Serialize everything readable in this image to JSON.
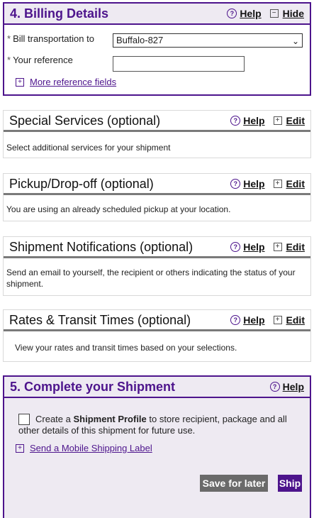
{
  "billing": {
    "title": "4. Billing Details",
    "help": "Help",
    "hide": "Hide",
    "bill_label": "Bill transportation to",
    "bill_value": "Buffalo-827",
    "reference_label": "Your reference",
    "reference_value": "",
    "more_fields": "More reference fields"
  },
  "special": {
    "title": "Special Services (optional)",
    "help": "Help",
    "edit": "Edit",
    "text": "Select additional services for your shipment"
  },
  "pickup": {
    "title": "Pickup/Drop-off (optional)",
    "help": "Help",
    "edit": "Edit",
    "text": "You are using an already scheduled pickup at your location."
  },
  "notifications": {
    "title": "Shipment Notifications (optional)",
    "help": "Help",
    "edit": "Edit",
    "text": "Send an email to yourself, the recipient or others indicating the status of your shipment."
  },
  "rates": {
    "title": "Rates & Transit Times (optional)",
    "help": "Help",
    "edit": "Edit",
    "text": "View your rates and transit times based on your selections."
  },
  "complete": {
    "title": "5. Complete your Shipment",
    "help": "Help",
    "profile_pre": "Create a ",
    "profile_bold": "Shipment Profile",
    "profile_post": " to store recipient, package and all other details of this shipment for future use.",
    "mobile_label": "Send a Mobile Shipping Label",
    "save": "Save for later",
    "ship": "Ship"
  },
  "icons": {
    "help": "question-circle-icon",
    "minus": "minus-box-icon",
    "plus": "plus-box-icon"
  },
  "colors": {
    "brand_purple": "#4d148c",
    "header_tint": "#eeeaf2",
    "save_button": "#6a6a6a"
  }
}
